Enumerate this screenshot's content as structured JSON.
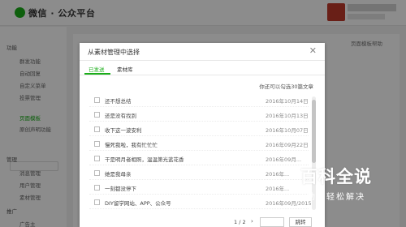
{
  "app": {
    "title": "微信 · 公众平台"
  },
  "sidebar": {
    "sections": [
      "功能",
      "管理",
      "推广"
    ],
    "items": [
      "群发功能",
      "自动回复",
      "自定义菜单",
      "投票管理",
      "页面模板",
      "原创声明功能",
      "消息管理",
      "用户管理",
      "素材管理",
      "广告主"
    ]
  },
  "background": {
    "right_link": "页面模板帮助"
  },
  "modal": {
    "title": "从素材管理中选择",
    "close_icon": "close-icon",
    "tabs": [
      {
        "label": "已发送"
      },
      {
        "label": "素材库"
      }
    ],
    "hint": "你还可以勾选30篇文章",
    "rows": [
      {
        "title": "还不想总结",
        "date": "2016年10月14日"
      },
      {
        "title": "还是没有找到",
        "date": "2016年10月13日"
      },
      {
        "title": "收下这一波安利",
        "date": "2016年10月07日"
      },
      {
        "title": "慢死我啦，我有忙忙忙",
        "date": "2016年09月22日"
      },
      {
        "title": "干是明月者相照，温温第光蓝花香",
        "date": "2016年09月..."
      },
      {
        "title": "她是我母亲",
        "date": "2016年..."
      },
      {
        "title": "一刻都没停下",
        "date": "2016年..."
      },
      {
        "title": "DIY留学网站、APP、公众号",
        "date": "2016年09月/2015"
      }
    ],
    "pager": {
      "page": "1 / 2",
      "next_icon": "chevron-right-icon",
      "jump": "跳转"
    }
  },
  "watermark": {
    "main": "百科全说",
    "sub": "助你轻松解决"
  }
}
